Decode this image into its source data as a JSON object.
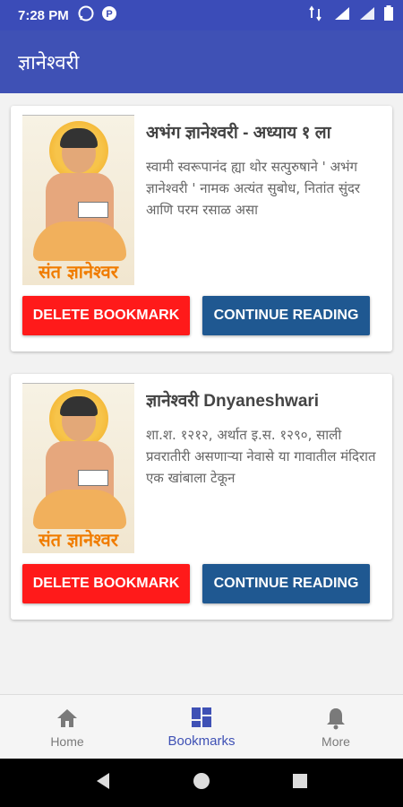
{
  "status_bar": {
    "time": "7:28 PM",
    "icons_left": [
      "whatsapp-icon",
      "paytm-icon"
    ],
    "icons_right": [
      "data-icon",
      "signal-icon",
      "signal-icon-2",
      "battery-icon"
    ]
  },
  "app_bar": {
    "title": "ज्ञानेश्वरी"
  },
  "bookmarks": [
    {
      "title": "अभंग ज्ञानेश्वरी - अध्याय १ ला",
      "description": "स्वामी स्वरूपानंद ह्या थोर सत्पुरुषाने ' अभंग ज्ञानेश्वरी ' नामक अत्यंत सुबोध, नितांत सुंदर आणि परम रसाळ असा",
      "image_caption": "संत ज्ञानेश्वर",
      "delete_label": "DELETE BOOKMARK",
      "continue_label": "CONTINUE READING"
    },
    {
      "title": "ज्ञानेश्वरी Dnyaneshwari",
      "description": "शा.श. १२१२, अर्थात इ.स. १२९०, साली प्रवरातीरी असणाऱ्या नेवासे या गावातील मंदिरात एक खांबाला टेकून",
      "image_caption": "संत ज्ञानेश्वर",
      "delete_label": "DELETE BOOKMARK",
      "continue_label": "CONTINUE READING"
    }
  ],
  "bottom_nav": {
    "items": [
      {
        "label": "Home",
        "icon": "home-icon",
        "active": false
      },
      {
        "label": "Bookmarks",
        "icon": "dashboard-icon",
        "active": true
      },
      {
        "label": "More",
        "icon": "bell-icon",
        "active": false
      }
    ]
  },
  "colors": {
    "primary": "#3f51b5",
    "delete_button": "#ff1a1a",
    "continue_button": "#1f5891",
    "active_nav": "#3f51b5"
  }
}
